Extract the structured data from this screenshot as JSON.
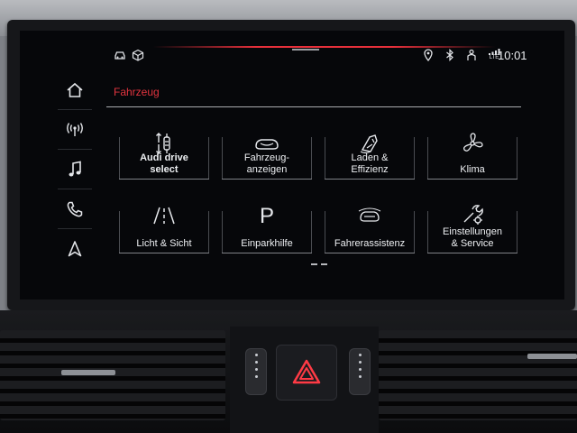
{
  "status_bar": {
    "time": "10:01",
    "left_icons": [
      "car-connect-icon",
      "package-icon"
    ],
    "right_icons": [
      "location-pin-icon",
      "bluetooth-icon",
      "person-icon",
      "lte-signal-icon"
    ],
    "lte_label": "LTE"
  },
  "sidenav": {
    "items": [
      {
        "name": "home",
        "icon": "home-icon"
      },
      {
        "name": "radio",
        "icon": "antenna-icon"
      },
      {
        "name": "media",
        "icon": "music-note-icon"
      },
      {
        "name": "phone",
        "icon": "phone-icon"
      },
      {
        "name": "navigation",
        "icon": "navigation-arrow-icon"
      }
    ]
  },
  "header": {
    "title": "Fahrzeug"
  },
  "tiles": [
    {
      "label_1": "Audi drive",
      "label_2": "select",
      "icon": "drive-select-icon"
    },
    {
      "label_1": "Fahrzeug-",
      "label_2": "anzeigen",
      "icon": "car-display-icon"
    },
    {
      "label_1": "Laden &",
      "label_2": "Effizienz",
      "icon": "charging-icon"
    },
    {
      "label_1": "Klima",
      "label_2": "",
      "icon": "fan-icon"
    },
    {
      "label_1": "Licht & Sicht",
      "label_2": "",
      "icon": "road-light-icon"
    },
    {
      "label_1": "Einparkhilfe",
      "label_2": "",
      "icon": "parking-icon",
      "icon_glyph": "P"
    },
    {
      "label_1": "Fahrerassistenz",
      "label_2": "",
      "icon": "driver-assist-icon"
    },
    {
      "label_1": "Einstellungen",
      "label_2": "& Service",
      "icon": "settings-service-icon"
    }
  ],
  "colors": {
    "accent_red": "#e2343f",
    "text": "#eef0f3",
    "screen_bg": "#06070a"
  }
}
